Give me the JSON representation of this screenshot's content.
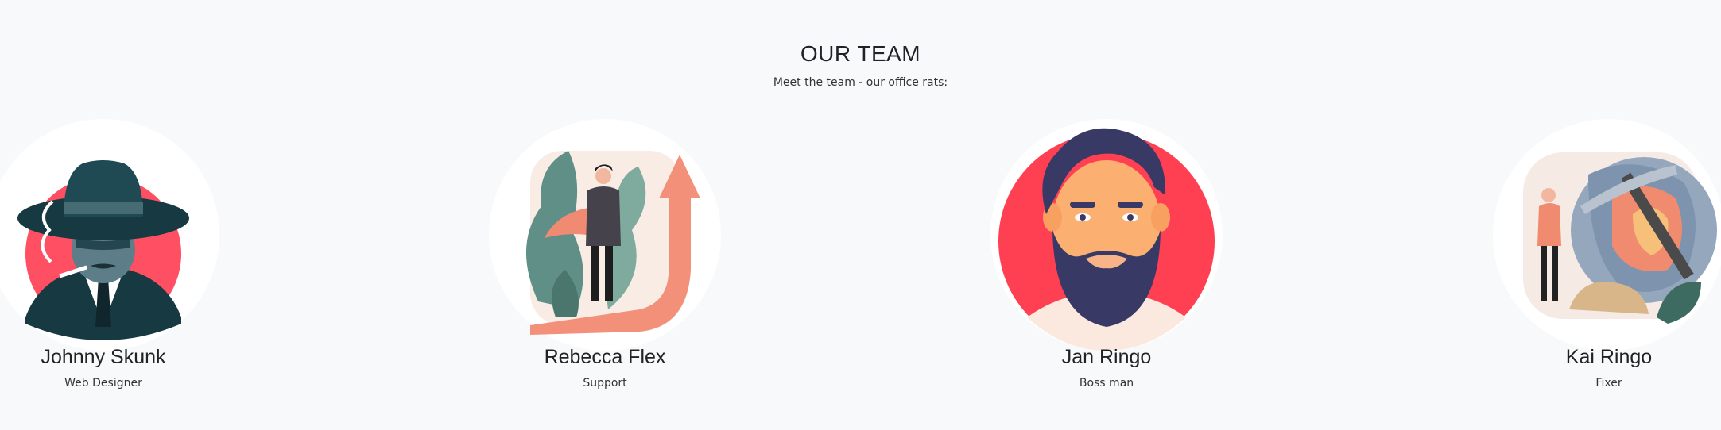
{
  "section": {
    "title": "OUR TEAM",
    "subtitle": "Meet the team - our office rats:"
  },
  "members": [
    {
      "name": "Johnny Skunk",
      "role": "Web Designer",
      "avatar_icon": "detective-avatar-icon"
    },
    {
      "name": "Rebecca Flex",
      "role": "Support",
      "avatar_icon": "businessman-growth-avatar-icon"
    },
    {
      "name": "Jan Ringo",
      "role": "Boss man",
      "avatar_icon": "bearded-man-avatar-icon"
    },
    {
      "name": "Kai Ringo",
      "role": "Fixer",
      "avatar_icon": "miner-globe-avatar-icon"
    }
  ],
  "colors": {
    "background": "#f8f9fb",
    "accent_red": "#ff4052",
    "navy": "#3a3b68",
    "teal_dark": "#1a3d46",
    "salmon": "#f2917a"
  }
}
